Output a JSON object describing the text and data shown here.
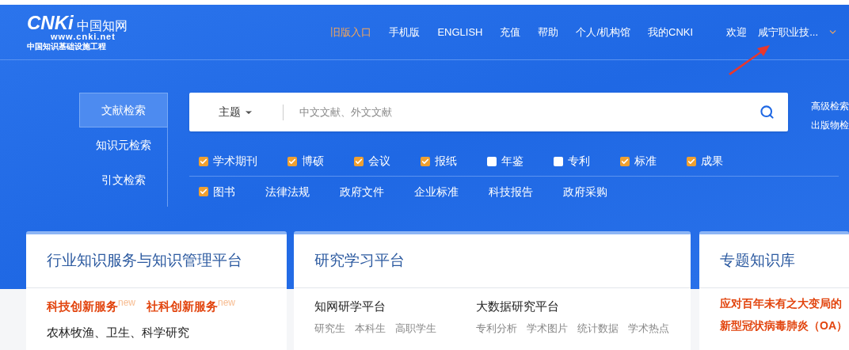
{
  "logo": {
    "brand": "CNKi",
    "chinese": "中国知网",
    "url": "www.cnki.net",
    "tagline": "中国知识基础设施工程"
  },
  "top_nav": [
    {
      "label": "旧版入口",
      "highlight": true
    },
    {
      "label": "手机版",
      "highlight": false
    },
    {
      "label": "ENGLISH",
      "highlight": false
    },
    {
      "label": "充值",
      "highlight": false
    },
    {
      "label": "帮助",
      "highlight": false
    },
    {
      "label": "个人/机构馆",
      "highlight": false
    },
    {
      "label": "我的CNKI",
      "highlight": false
    }
  ],
  "user": {
    "greeting": "欢迎",
    "name": "咸宁职业技..."
  },
  "search_tabs": [
    {
      "label": "文献检索",
      "selected": true
    },
    {
      "label": "知识元检索",
      "selected": false
    },
    {
      "label": "引文检索",
      "selected": false
    }
  ],
  "search": {
    "field": "主题",
    "placeholder": "中文文献、外文文献"
  },
  "side_links": [
    "高级检索",
    "出版物检"
  ],
  "source_rows": [
    [
      {
        "kind": "checkbox",
        "label": "学术期刊",
        "checked": true
      },
      {
        "kind": "checkbox",
        "label": "博硕",
        "checked": true
      },
      {
        "kind": "checkbox",
        "label": "会议",
        "checked": true
      },
      {
        "kind": "checkbox",
        "label": "报纸",
        "checked": true
      },
      {
        "kind": "checkbox",
        "label": "年鉴",
        "checked": false
      },
      {
        "kind": "checkbox",
        "label": "专利",
        "checked": false
      },
      {
        "kind": "checkbox",
        "label": "标准",
        "checked": true
      },
      {
        "kind": "checkbox",
        "label": "成果",
        "checked": true
      }
    ],
    [
      {
        "kind": "checkbox",
        "label": "图书",
        "checked": true
      },
      {
        "kind": "link",
        "label": "法律法规"
      },
      {
        "kind": "link",
        "label": "政府文件"
      },
      {
        "kind": "link",
        "label": "企业标准"
      },
      {
        "kind": "link",
        "label": "科技报告"
      },
      {
        "kind": "link",
        "label": "政府采购"
      }
    ]
  ],
  "cards": [
    {
      "title": "行业知识服务与知识管理平台",
      "kind": "services",
      "featured": [
        "科技创新服务$^{new}$",
        "社科创新服务$^{new}$"
      ],
      "text": "农林牧渔、卫生、科学研究"
    },
    {
      "title": "研究学习平台",
      "kind": "platforms",
      "platforms": [
        {
          "name": "知网研学平台",
          "links": [
            "研究生",
            "本科生",
            "高职学生"
          ]
        },
        {
          "name": "大数据研究平台",
          "links": [
            "专利分析",
            "学术图片",
            "统计数据",
            "学术热点"
          ]
        }
      ]
    },
    {
      "title": "专题知识库",
      "kind": "topics",
      "topics": [
        "应对百年未有之大变局的",
        "新型冠状病毒肺炎（OA）"
      ]
    }
  ]
}
